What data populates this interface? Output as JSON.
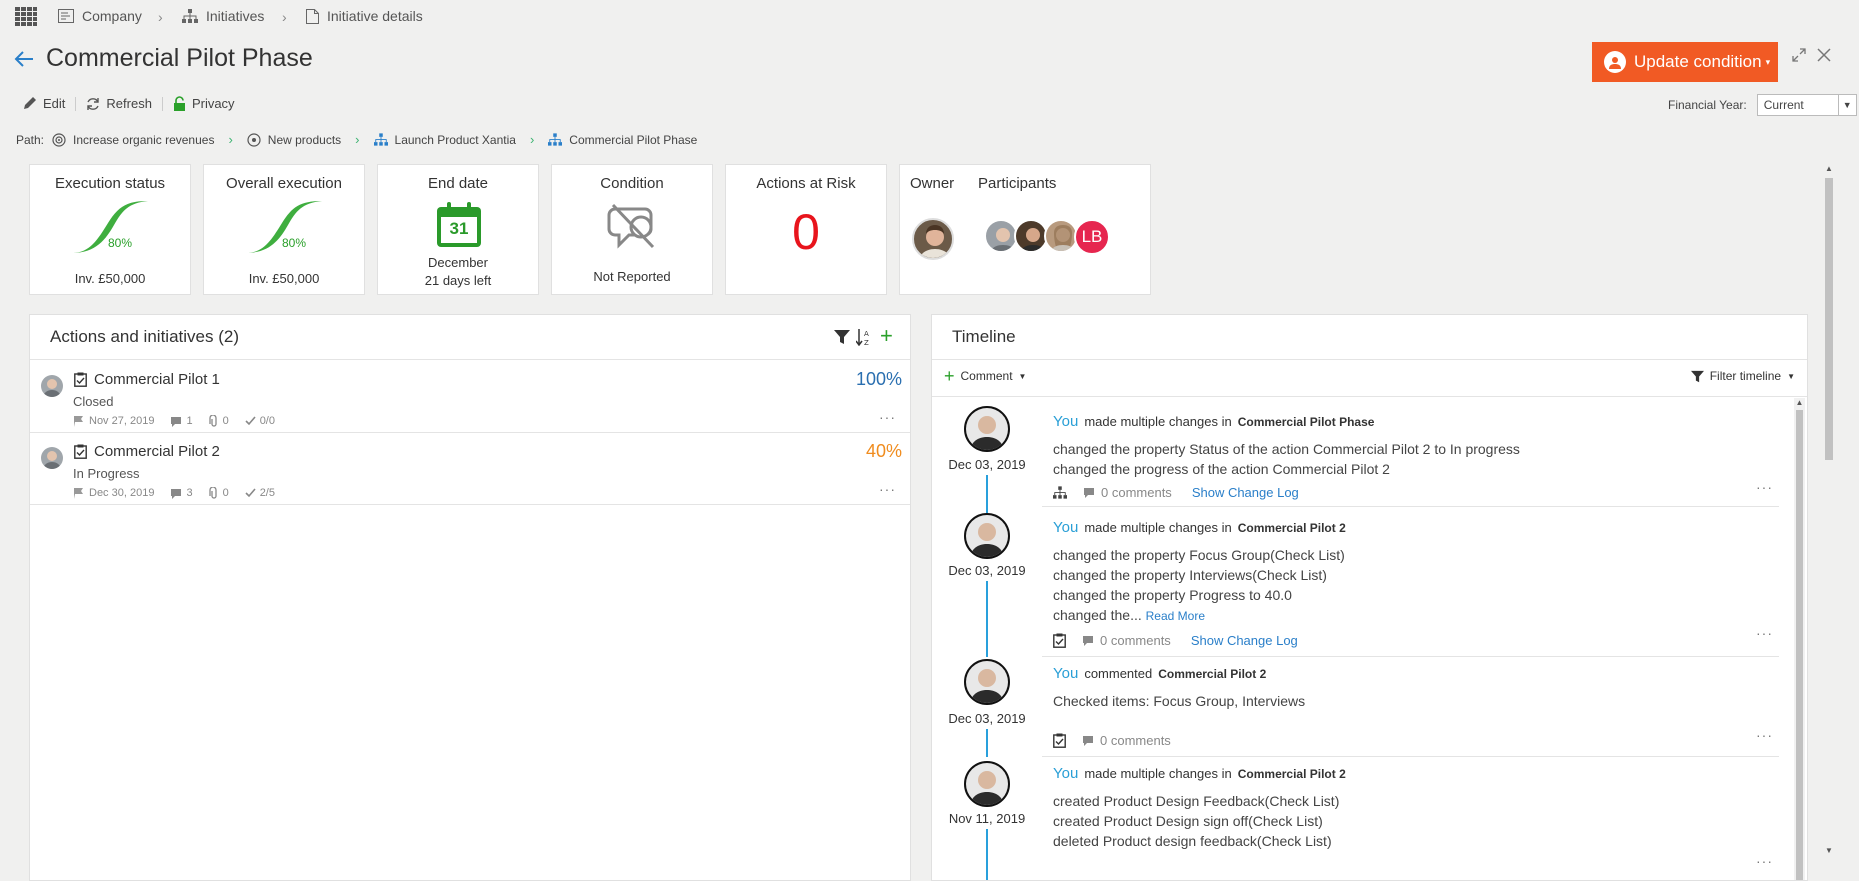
{
  "breadcrumb": {
    "items": [
      {
        "label": "Company",
        "icon": "company-icon"
      },
      {
        "label": "Initiatives",
        "icon": "hierarchy-icon"
      },
      {
        "label": "Initiative details",
        "icon": "document-icon"
      }
    ]
  },
  "page": {
    "title": "Commercial Pilot Phase"
  },
  "header": {
    "update_label": "Update condition"
  },
  "toolbar": {
    "edit": "Edit",
    "refresh": "Refresh",
    "privacy": "Privacy"
  },
  "financial_year": {
    "label": "Financial Year:",
    "value": "Current"
  },
  "path": {
    "label": "Path:",
    "items": [
      "Increase organic revenues",
      "New products",
      "Launch Product Xantia",
      "Commercial Pilot Phase"
    ]
  },
  "kpis": {
    "execution": {
      "title": "Execution status",
      "percent": "80%",
      "footer": "Inv. £50,000"
    },
    "overall": {
      "title": "Overall execution",
      "percent": "80%",
      "footer": "Inv. £50,000"
    },
    "end_date": {
      "title": "End date",
      "day": "31",
      "month": "December",
      "left": "21 days left"
    },
    "condition": {
      "title": "Condition",
      "value": "Not Reported"
    },
    "risk": {
      "title": "Actions at Risk",
      "value": "0"
    },
    "people": {
      "owner": "Owner",
      "participants": "Participants",
      "initials": "LB"
    }
  },
  "colors": {
    "accent": "#f15a24",
    "success": "#2aa02a",
    "danger": "#e8141c",
    "link": "#2a7fc9",
    "progress_mid": "#f08c1e",
    "progress_full": "#2a6fb0"
  },
  "actions": {
    "title": "Actions and initiatives (2)",
    "items": [
      {
        "title": "Commercial Pilot 1",
        "status": "Closed",
        "percent": "100%",
        "date": "Nov 27, 2019",
        "comments": "1",
        "attachments": "0",
        "checks": "0/0"
      },
      {
        "title": "Commercial Pilot 2",
        "status": "In Progress",
        "percent": "40%",
        "date": "Dec 30, 2019",
        "comments": "3",
        "attachments": "0",
        "checks": "2/5"
      }
    ]
  },
  "timeline": {
    "title": "Timeline",
    "comment_label": "Comment",
    "filter_label": "Filter timeline",
    "entries": [
      {
        "date": "Dec 03, 2019",
        "you": "You",
        "verb": "made multiple changes in",
        "target": "Commercial Pilot Phase",
        "lines": [
          "changed the property Status of the action Commercial Pilot 2 to In progress",
          "changed the progress of the action Commercial Pilot 2"
        ],
        "comments": "0 comments",
        "change_log": "Show Change Log"
      },
      {
        "date": "Dec 03, 2019",
        "you": "You",
        "verb": "made multiple changes in",
        "target": "Commercial Pilot 2",
        "lines": [
          "changed the property Focus Group(Check List)",
          "changed the property Interviews(Check List)",
          "changed the property Progress to 40.0"
        ],
        "truncated": "changed the...",
        "read_more": "Read More",
        "comments": "0 comments",
        "change_log": "Show Change Log"
      },
      {
        "date": "Dec 03, 2019",
        "you": "You",
        "verb": "commented",
        "target": "Commercial Pilot 2",
        "lines": [
          "Checked items: Focus Group, Interviews"
        ],
        "comments": "0 comments"
      },
      {
        "date": "Nov 11, 2019",
        "you": "You",
        "verb": "made multiple changes in",
        "target": "Commercial Pilot 2",
        "lines": [
          "created Product Design Feedback(Check List)",
          "created Product Design sign off(Check List)",
          "deleted Product design feedback(Check List)"
        ]
      }
    ]
  }
}
